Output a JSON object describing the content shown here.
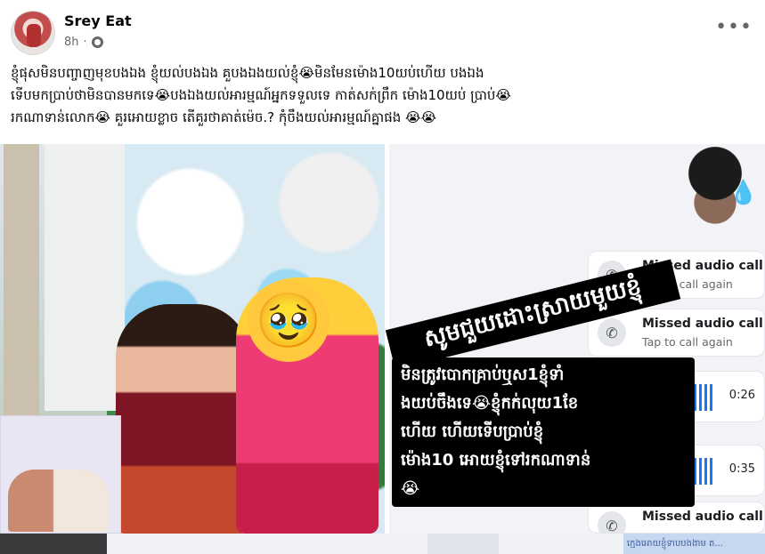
{
  "post": {
    "author": "Srey Eat",
    "time": "8h",
    "more_label": "•••",
    "caption_lines": [
      "ខ្ញុំផុសមិនបញ្ចាញមុខបងឯង ខ្ញុំយល់បងឯង គួបងឯងយល់ខ្ញុំ😭មិនមែនម៉ោង10យប់ហើយ បងឯង",
      "ទើបមកប្រាប់ថាមិនបានមកទេ😭បងឯងយល់អារម្មណ៍អ្នកទទួលទេ កាត់សក់ព្រឹក ម៉ោង10យប់ ប្រាប់😭",
      "រកណាទាន់លោក😭 គួរអោយខ្លាច តើគួរថាគាត់ម៉េច.? កុំចឹងយល់អារម្មណ៍គ្នាផង 😭😭"
    ]
  },
  "media": {
    "left_photo": {
      "emoji": "🥹"
    },
    "right_photo": {
      "rotated_text": "សូមជួយដោះស្រាយមួយខ្ញុំ",
      "calls": [
        {
          "title": "Missed audio call",
          "subtitle": "Tap to call again"
        },
        {
          "title": "Missed audio call",
          "subtitle": "Tap to call again"
        },
        {
          "title": "Missed audio call",
          "subtitle": ""
        }
      ],
      "voice_messages": [
        {
          "duration": "0:26"
        },
        {
          "duration": "0:35"
        }
      ],
      "message_lines": [
        "មិនត្រូវបោកគ្រាប់ឬស1ខ្ញុំទាំ",
        "ងយប់ចឹងទេ😭ខ្ញុំកក់លុយ1ខែ",
        "ហើយ ហើយទើបប្រាប់ខ្ញុំ",
        "ម៉ោង10 អោយខ្ញុំទៅរកណាទាន់",
        "😭"
      ]
    }
  },
  "strip": {
    "caption_snippet": "ក្មេងអោយខ្ញុំទាបបងងាម ត..."
  },
  "colors": {
    "accent": "#1877f2",
    "text": "#050505",
    "secondary": "#65676b"
  },
  "icons": {
    "privacy": "globe-icon",
    "missed_call": "missed-call-icon",
    "voice": "waveform-icon"
  }
}
